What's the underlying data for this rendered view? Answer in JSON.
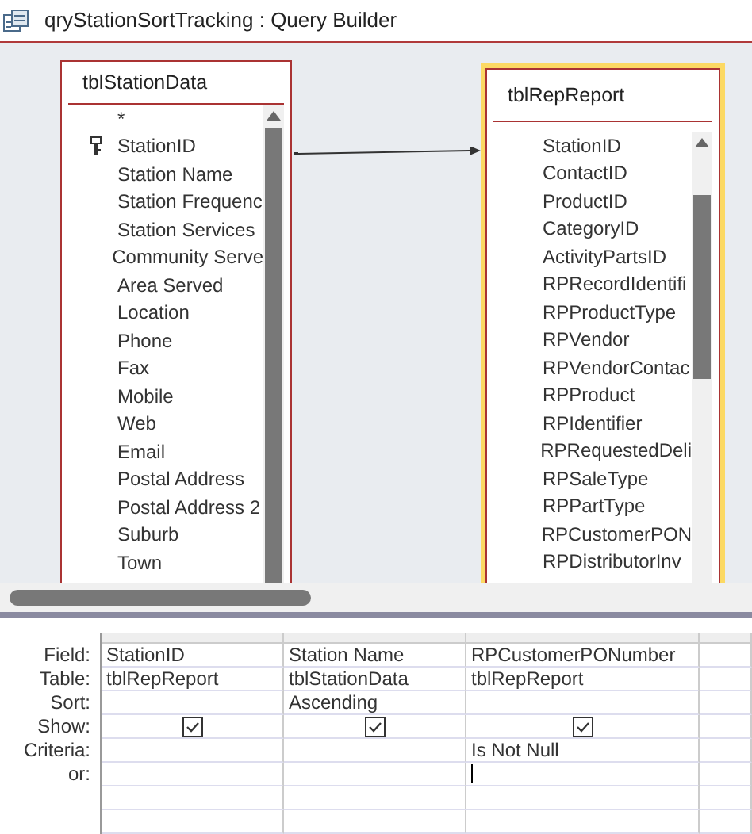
{
  "window": {
    "title": "qryStationSortTracking : Query Builder"
  },
  "tables": [
    {
      "name": "tblStationData",
      "selected": false,
      "fields": [
        {
          "name": "*",
          "primary_key": false
        },
        {
          "name": "StationID",
          "primary_key": true
        },
        {
          "name": "Station Name",
          "primary_key": false
        },
        {
          "name": "Station Frequenc",
          "primary_key": false
        },
        {
          "name": "Station Services",
          "primary_key": false
        },
        {
          "name": "Community Serve",
          "primary_key": false
        },
        {
          "name": "Area Served",
          "primary_key": false
        },
        {
          "name": "Location",
          "primary_key": false
        },
        {
          "name": "Phone",
          "primary_key": false
        },
        {
          "name": "Fax",
          "primary_key": false
        },
        {
          "name": "Mobile",
          "primary_key": false
        },
        {
          "name": "Web",
          "primary_key": false
        },
        {
          "name": "Email",
          "primary_key": false
        },
        {
          "name": "Postal Address",
          "primary_key": false
        },
        {
          "name": "Postal Address 2",
          "primary_key": false
        },
        {
          "name": "Suburb",
          "primary_key": false
        },
        {
          "name": "Town",
          "primary_key": false
        }
      ]
    },
    {
      "name": "tblRepReport",
      "selected": true,
      "fields": [
        {
          "name": "StationID",
          "primary_key": false
        },
        {
          "name": "ContactID",
          "primary_key": false
        },
        {
          "name": "ProductID",
          "primary_key": false
        },
        {
          "name": "CategoryID",
          "primary_key": false
        },
        {
          "name": "ActivityPartsID",
          "primary_key": false
        },
        {
          "name": "RPRecordIdentifi",
          "primary_key": false
        },
        {
          "name": "RPProductType",
          "primary_key": false
        },
        {
          "name": "RPVendor",
          "primary_key": false
        },
        {
          "name": "RPVendorContac",
          "primary_key": false
        },
        {
          "name": "RPProduct",
          "primary_key": false
        },
        {
          "name": "RPIdentifier",
          "primary_key": false
        },
        {
          "name": "RPRequestedDeli",
          "primary_key": false
        },
        {
          "name": "RPSaleType",
          "primary_key": false
        },
        {
          "name": "RPPartType",
          "primary_key": false
        },
        {
          "name": "RPCustomerPON",
          "primary_key": false
        },
        {
          "name": "RPDistributorInv",
          "primary_key": false
        }
      ]
    }
  ],
  "grid": {
    "rows": [
      {
        "label": "Field:",
        "kind": "text",
        "cells": [
          {
            "text": "StationID"
          },
          {
            "text": "Station Name"
          },
          {
            "text": "RPCustomerPONumber"
          }
        ]
      },
      {
        "label": "Table:",
        "kind": "text",
        "cells": [
          {
            "text": "tblRepReport"
          },
          {
            "text": "tblStationData"
          },
          {
            "text": "tblRepReport"
          }
        ]
      },
      {
        "label": "Sort:",
        "kind": "text",
        "cells": [
          {
            "text": ""
          },
          {
            "text": "Ascending"
          },
          {
            "text": ""
          }
        ]
      },
      {
        "label": "Show:",
        "kind": "checkbox",
        "cells": [
          {
            "checked": true
          },
          {
            "checked": true
          },
          {
            "checked": true
          }
        ]
      },
      {
        "label": "Criteria:",
        "kind": "text",
        "cells": [
          {
            "text": ""
          },
          {
            "text": ""
          },
          {
            "text": "Is Not Null"
          }
        ]
      },
      {
        "label": "or:",
        "kind": "text",
        "cells": [
          {
            "text": ""
          },
          {
            "text": ""
          },
          {
            "text": "",
            "focused": true
          }
        ]
      }
    ]
  }
}
